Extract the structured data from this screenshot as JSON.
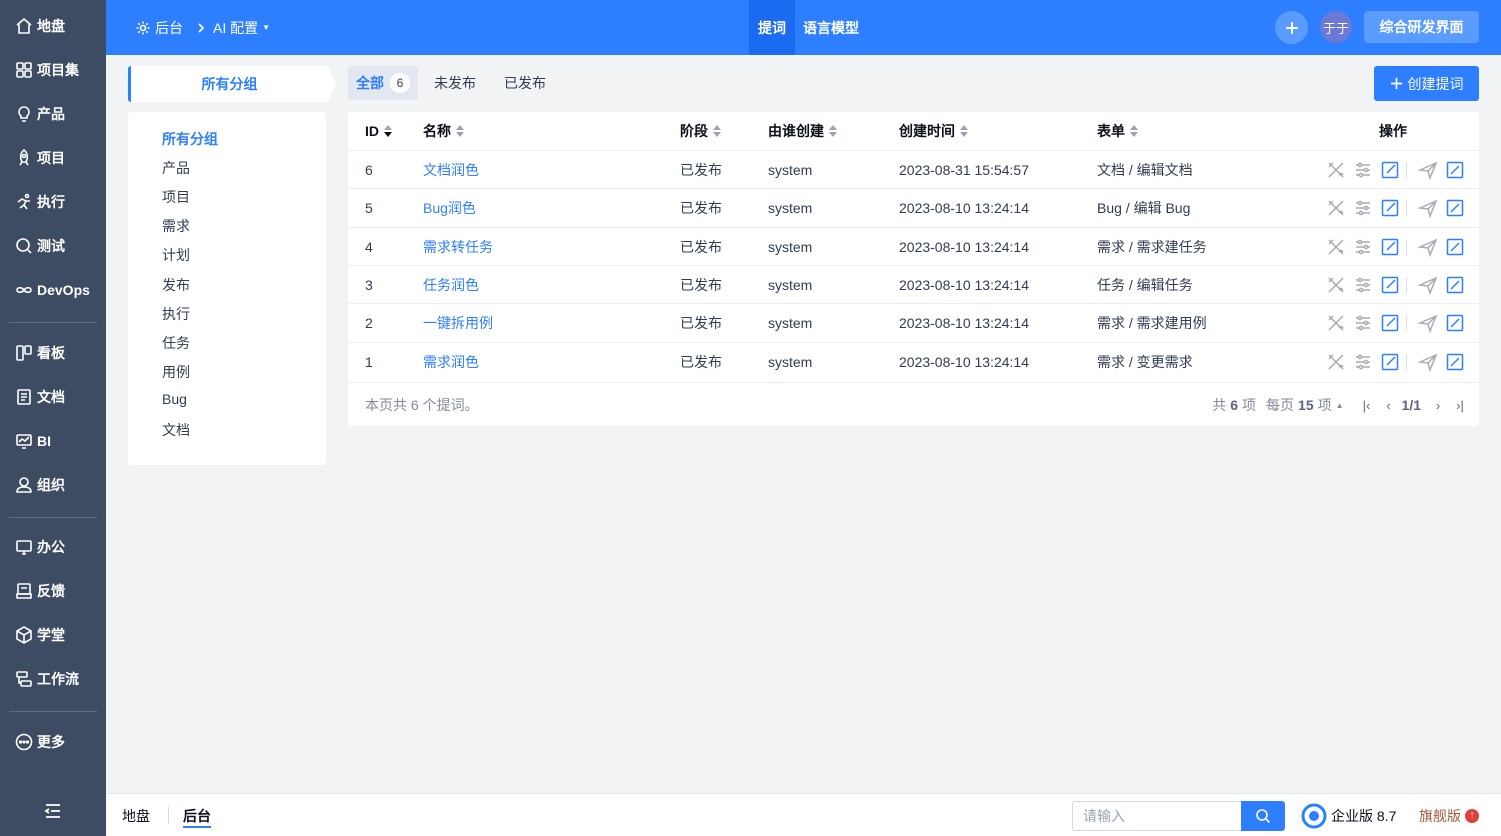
{
  "sidebar": {
    "items": [
      {
        "label": "地盘",
        "icon": "home-icon"
      },
      {
        "label": "项目集",
        "icon": "grid-icon"
      },
      {
        "label": "产品",
        "icon": "lightbulb-icon"
      },
      {
        "label": "项目",
        "icon": "rocket-icon"
      },
      {
        "label": "执行",
        "icon": "run-icon"
      },
      {
        "label": "测试",
        "icon": "magnifier-icon"
      },
      {
        "label": "DevOps",
        "icon": "infinity-icon"
      },
      {
        "label": "看板",
        "icon": "kanban-icon"
      },
      {
        "label": "文档",
        "icon": "doc-icon"
      },
      {
        "label": "BI",
        "icon": "monitor-chart-icon"
      },
      {
        "label": "组织",
        "icon": "user-icon"
      },
      {
        "label": "办公",
        "icon": "oa-icon"
      },
      {
        "label": "反馈",
        "icon": "feedback-icon"
      },
      {
        "label": "学堂",
        "icon": "cube-icon"
      },
      {
        "label": "工作流",
        "icon": "workflow-icon"
      },
      {
        "label": "更多",
        "icon": "more-icon"
      }
    ]
  },
  "header": {
    "breadcrumb_home": "后台",
    "breadcrumb_current": "AI 配置",
    "tabs": [
      "提词",
      "语言模型"
    ],
    "avatar_text": "于于",
    "switch_button": "综合研发界面"
  },
  "group": {
    "title": "所有分组",
    "items": [
      "所有分组",
      "产品",
      "项目",
      "需求",
      "计划",
      "发布",
      "执行",
      "任务",
      "用例",
      "Bug",
      "文档"
    ]
  },
  "tabs": {
    "all": "全部",
    "all_count": "6",
    "unpublished": "未发布",
    "published": "已发布"
  },
  "create_button": "创建提词",
  "table": {
    "headers": [
      "ID",
      "名称",
      "阶段",
      "由谁创建",
      "创建时间",
      "表单",
      "操作"
    ],
    "rows": [
      {
        "id": "6",
        "name": "文档润色",
        "stage": "已发布",
        "creator": "system",
        "time": "2023-08-31 15:54:57",
        "form": "文档 / 编辑文档"
      },
      {
        "id": "5",
        "name": "Bug润色",
        "stage": "已发布",
        "creator": "system",
        "time": "2023-08-10 13:24:14",
        "form": "Bug / 编辑 Bug"
      },
      {
        "id": "4",
        "name": "需求转任务",
        "stage": "已发布",
        "creator": "system",
        "time": "2023-08-10 13:24:14",
        "form": "需求 / 需求建任务"
      },
      {
        "id": "3",
        "name": "任务润色",
        "stage": "已发布",
        "creator": "system",
        "time": "2023-08-10 13:24:14",
        "form": "任务 / 编辑任务"
      },
      {
        "id": "2",
        "name": "一键拆用例",
        "stage": "已发布",
        "creator": "system",
        "time": "2023-08-10 13:24:14",
        "form": "需求 / 需求建用例"
      },
      {
        "id": "1",
        "name": "需求润色",
        "stage": "已发布",
        "creator": "system",
        "time": "2023-08-10 13:24:14",
        "form": "需求 / 变更需求"
      }
    ],
    "summary": "本页共 6 个提词。",
    "pager": {
      "total_prefix": "共",
      "total": "6",
      "total_suffix": "项",
      "per_page_prefix": "每页",
      "per_page": "15",
      "per_page_suffix": "项",
      "page": "1/1"
    }
  },
  "footer": {
    "links": [
      "地盘",
      "后台"
    ],
    "search_placeholder": "请输入",
    "edition": "企业版 8.7",
    "flagship": "旗舰版"
  },
  "colors": {
    "primary": "#2e7fff",
    "sidebar": "#3d4c63"
  }
}
